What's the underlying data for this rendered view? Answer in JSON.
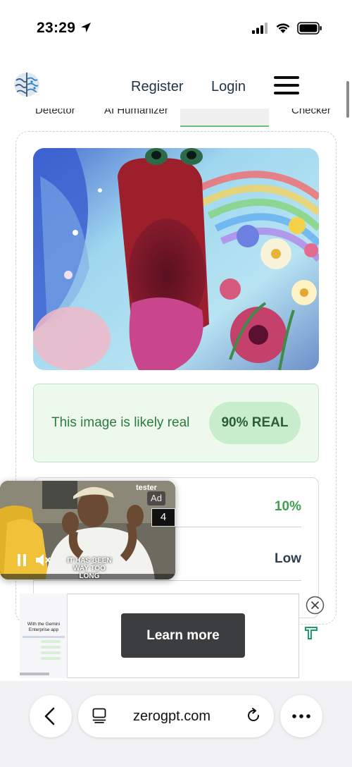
{
  "status_bar": {
    "time": "23:29"
  },
  "header": {
    "register_label": "Register",
    "login_label": "Login"
  },
  "tabs": [
    "Detector",
    "AI Humanizer",
    "",
    "Checker"
  ],
  "result": {
    "text": "This image is likely real",
    "badge": "90% REAL"
  },
  "details": [
    {
      "value": "10%"
    },
    {
      "value": "Low"
    }
  ],
  "video_ad": {
    "brand": "tester",
    "ad_label": "Ad",
    "countdown": "4",
    "caption": "IT HAS BEEN WAY TOO LONG"
  },
  "banner_ad": {
    "thumb_title": "With the Gemini Enterprise app",
    "cta": "Learn more"
  },
  "browser": {
    "url": "zerogpt.com"
  },
  "colors": {
    "accent_green": "#3fa14f",
    "result_bg": "#eef9ee",
    "pill_bg": "#c7edcc"
  }
}
